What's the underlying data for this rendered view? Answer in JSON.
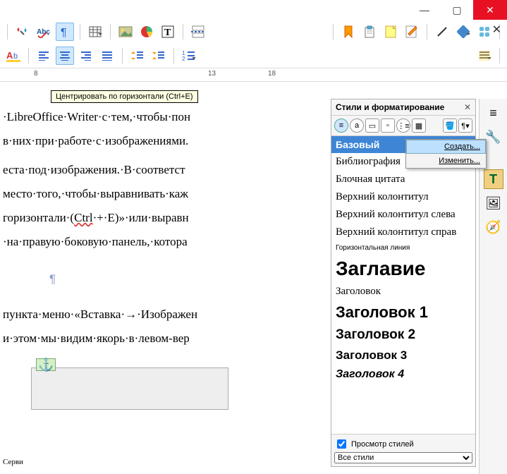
{
  "window": {
    "close": "✕",
    "restore": "▢",
    "minimize": "—"
  },
  "tooltip": "Центрировать по горизонтали (Ctrl+E)",
  "ruler": {
    "t1": "8",
    "t2": "13",
    "t3": "18"
  },
  "doc": {
    "l1": "·LibreOffice·Writer·с·тем,·чтобы·пон",
    "l2": "в·них·при·работе·с·изображениями.",
    "l3": "еста·под·изображения.·В·соответст",
    "l4": "место·того,·чтобы·выравнивать·каж",
    "l5a": "горизонтали·(",
    "l5b": "Ctrl",
    "l5c": "·+·E)»·или·выравн",
    "l6": "·на·правую·боковую·панель,·котора",
    "l7": "пункта·меню·«Вставка·→·Изображен",
    "l8": "и·этом·мы·видим·якорь·в·левом-вер",
    "service": "Серви"
  },
  "panel": {
    "title": "Стили и форматирование",
    "preview_label": "Просмотр стилей",
    "filter": "Все стили",
    "styles": {
      "s0": "Базовый",
      "s1": "Библиография",
      "s2": "Блочная цитата",
      "s3": "Верхний колонтитул",
      "s4": "Верхний колонтитул слева",
      "s5": "Верхний колонтитул справ",
      "s6": "Горизонтальная линия",
      "s7": "Заглавие",
      "s8": "Заголовок",
      "s9": "Заголовок 1",
      "s10": "Заголовок 2",
      "s11": "Заголовок 3",
      "s12": "Заголовок 4"
    }
  },
  "ctx": {
    "create": "Создать...",
    "modify": "Изменить..."
  }
}
